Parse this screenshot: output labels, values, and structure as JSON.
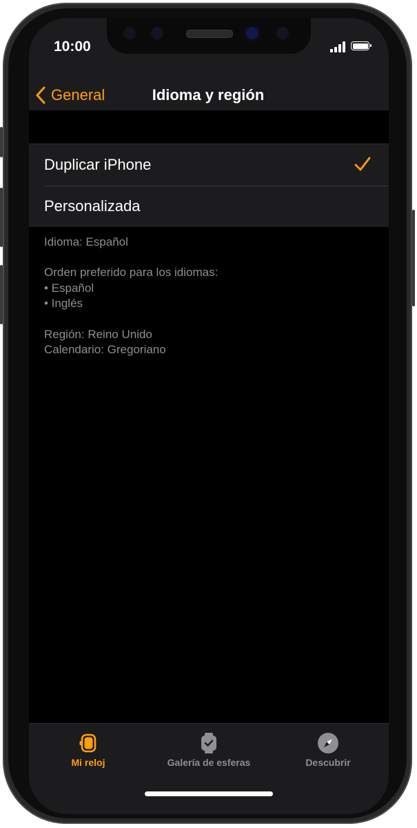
{
  "status_bar": {
    "time": "10:00"
  },
  "nav": {
    "back_label": "General",
    "title": "Idioma y región"
  },
  "options": [
    {
      "label": "Duplicar iPhone",
      "selected": true
    },
    {
      "label": "Personalizada",
      "selected": false
    }
  ],
  "info": {
    "language": "Idioma: Español",
    "preferred_order_title": "Orden preferido para los idiomas:",
    "preferred_1": "• Español",
    "preferred_2": "• Inglés",
    "region": "Región: Reino Unido",
    "calendar": "Calendario: Gregoriano"
  },
  "tabbar": {
    "tabs": [
      {
        "label": "Mi reloj",
        "icon": "watch-icon",
        "active": true
      },
      {
        "label": "Galería de esferas",
        "icon": "watch-face-gallery-icon",
        "active": false
      },
      {
        "label": "Descubrir",
        "icon": "compass-icon",
        "active": false
      }
    ]
  },
  "colors": {
    "accent": "#ff9f0a",
    "background": "#000000",
    "surface": "#1c1c1e",
    "secondary_text": "#8e8e93"
  }
}
